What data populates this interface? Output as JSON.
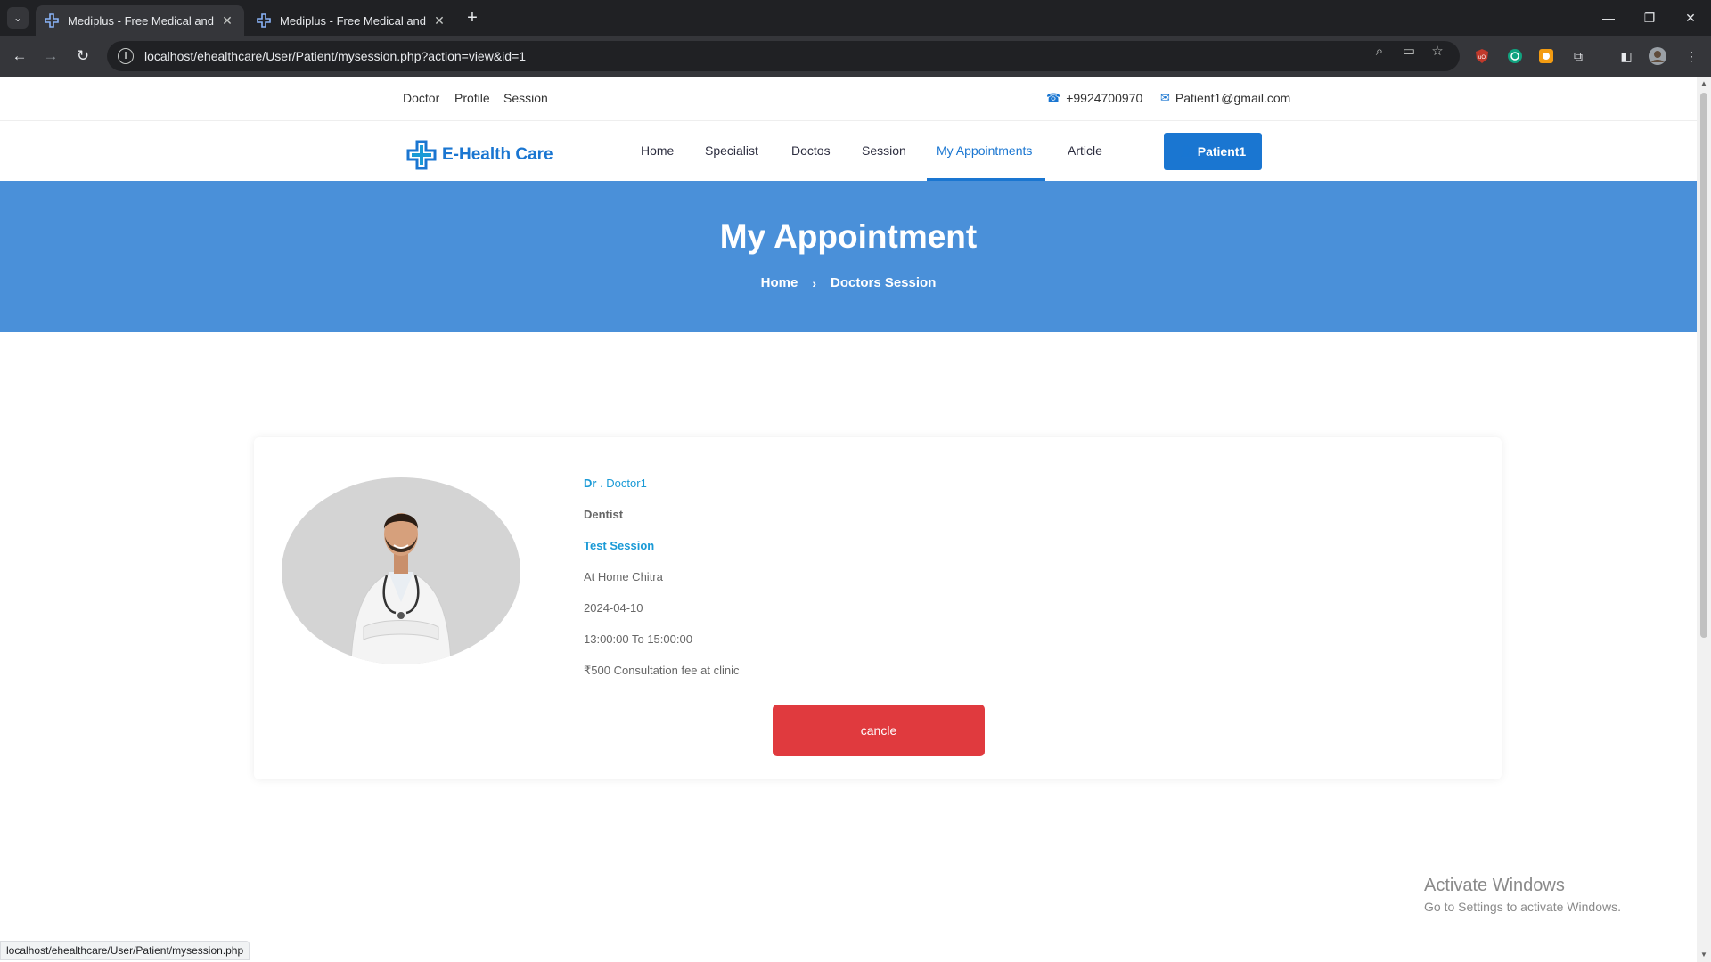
{
  "browser": {
    "tabs": [
      {
        "title": "Mediplus - Free Medical and Do",
        "active": true
      },
      {
        "title": "Mediplus - Free Medical and Do",
        "active": false
      }
    ],
    "url": "localhost/ehealthcare/User/Patient/mysession.php?action=view&id=1",
    "status_url": "localhost/ehealthcare/User/Patient/mysession.php"
  },
  "topbar": {
    "links": [
      "Doctor",
      "Profile",
      "Session"
    ],
    "phone": "+9924700970",
    "email": "Patient1@gmail.com"
  },
  "header": {
    "logo_text": "E-Health Care",
    "nav": [
      "Home",
      "Specialist",
      "Doctos",
      "Session",
      "My Appointments",
      "Article"
    ],
    "active_nav": "My Appointments",
    "user_button": "Patient1"
  },
  "hero": {
    "title": "My Appointment",
    "breadcrumb": [
      "Home",
      "Doctors Session"
    ]
  },
  "appointment": {
    "doctor_prefix": "Dr",
    "doctor_name": " . Doctor1",
    "specialty": "Dentist",
    "session_title": "Test Session",
    "location": "At Home Chitra",
    "date": "2024-04-10",
    "time": "13:00:00 To 15:00:00",
    "fee": "₹500 Consultation fee at clinic",
    "cancel_label": "cancle"
  },
  "watermark": {
    "line1": "Activate Windows",
    "line2": "Go to Settings to activate Windows."
  },
  "colors": {
    "brand_blue": "#1a76d1",
    "hero_blue": "#4a90d9",
    "cancel_red": "#e03a3e"
  }
}
